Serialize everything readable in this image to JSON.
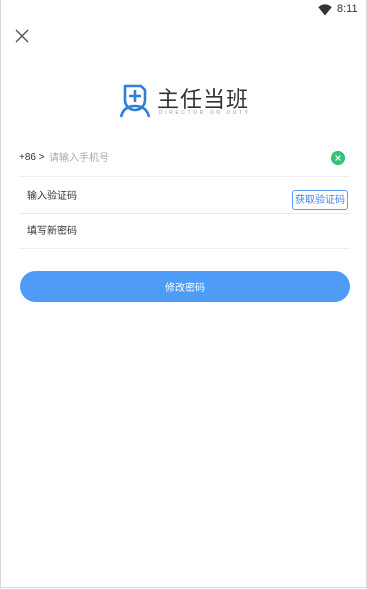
{
  "status_bar": {
    "time": "8:11",
    "icons": [
      "wifi-icon"
    ]
  },
  "close_icon": "close-icon",
  "logo": {
    "icon": "doctor-logo-icon",
    "title_cn": "主任当班",
    "subtitle_en": "DIRECTOR ON DUTY"
  },
  "form": {
    "phone": {
      "prefix": "+86 >",
      "placeholder": "请输入手机号",
      "value": "",
      "clear_icon": "clear-icon"
    },
    "code": {
      "placeholder": "输入验证码",
      "value": "",
      "get_code_label": "获取验证码"
    },
    "password": {
      "placeholder": "填写新密码",
      "value": ""
    }
  },
  "submit_label": "修改密码",
  "colors": {
    "accent": "#4e9cf6",
    "clear_green": "#2ec47a",
    "logo_blue": "#2f7fd9"
  }
}
